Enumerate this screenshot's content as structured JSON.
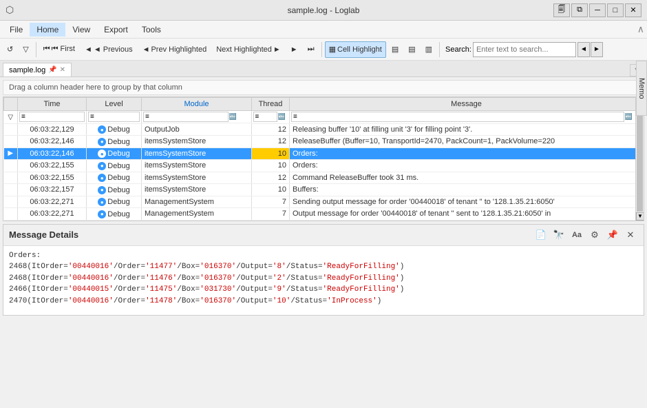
{
  "titleBar": {
    "icon": "⬡",
    "title": "sample.log - Loglab",
    "controls": [
      "🗐",
      "⧉",
      "─",
      "□",
      "✕"
    ]
  },
  "menuBar": {
    "items": [
      "File",
      "Home",
      "View",
      "Export",
      "Tools"
    ],
    "active": "Home"
  },
  "toolbar": {
    "refresh_label": "↺",
    "filter_label": "⊿",
    "first_label": "⏮ First",
    "prev_label": "◄ Previous",
    "prev_highlighted_label": "◄ Prev Highlighted",
    "next_highlighted_label": "Next Highlighted ►",
    "next_label": "Next ►",
    "last_label": "⏭",
    "cell_highlight_label": "Cell Highlight",
    "btn1_label": "▦",
    "btn2_label": "▤",
    "btn3_label": "▥",
    "search_label": "Search:",
    "search_placeholder": "Enter text to search..."
  },
  "tab": {
    "label": "sample.log",
    "pin": "📌"
  },
  "memo": "Memo",
  "dragHint": "Drag a column header here to group by that column",
  "table": {
    "columns": [
      "",
      "Time",
      "Level",
      "Module",
      "Thread",
      "Message"
    ],
    "filterRow": [
      "≡",
      "≡",
      "≡ c",
      "≡ c",
      "≡ c",
      "≡ c"
    ],
    "rows": [
      {
        "check": "",
        "time": "06:03:22,129",
        "level": "Debug",
        "module": "OutputJob",
        "thread": "12",
        "message": "Releasing buffer '10' at filling unit '3' for filling point '3'.",
        "selected": false,
        "arrow": false
      },
      {
        "check": "",
        "time": "06:03:22,146",
        "level": "Debug",
        "module": "itemsSystemStore",
        "thread": "12",
        "message": "ReleaseBuffer (Buffer=10, TransportId=2470, PackCount=1, PackVolume=220",
        "selected": false,
        "arrow": false
      },
      {
        "check": "",
        "time": "06:03:22,146",
        "level": "Debug",
        "module": "itemsSystemStore",
        "thread": "10",
        "message": "Orders:",
        "selected": true,
        "arrow": true,
        "yellowThread": true,
        "highlightMessage": true
      },
      {
        "check": "",
        "time": "06:03:22,155",
        "level": "Debug",
        "module": "itemsSystemStore",
        "thread": "10",
        "message": "Orders:",
        "selected": false,
        "arrow": false
      },
      {
        "check": "",
        "time": "06:03:22,155",
        "level": "Debug",
        "module": "itemsSystemStore",
        "thread": "12",
        "message": "Command ReleaseBuffer took 31 ms.",
        "selected": false,
        "arrow": false
      },
      {
        "check": "",
        "time": "06:03:22,157",
        "level": "Debug",
        "module": "itemsSystemStore",
        "thread": "10",
        "message": "Buffers:",
        "selected": false,
        "arrow": false
      },
      {
        "check": "",
        "time": "06:03:22,271",
        "level": "Debug",
        "module": "ManagementSystem",
        "thread": "7",
        "message": "Sending output message for order '00440018' of tenant '' to '128.1.35.21:6050'",
        "selected": false,
        "arrow": false
      },
      {
        "check": "",
        "time": "06:03:22,271",
        "level": "Debug",
        "module": "ManagementSystem",
        "thread": "7",
        "message": "Output message for order '00440018' of tenant '' sent to '128.1.35.21:6050' in",
        "selected": false,
        "arrow": false
      }
    ]
  },
  "messageDetails": {
    "title": "Message Details",
    "content": {
      "line1": "Orders:",
      "line2": "2468(ItOrder='00440016'/Order='11477'/Box='016370'/Output='8'/Status='ReadyForFilling')",
      "line3": "2468(ItOrder='00440016'/Order='11476'/Box='016370'/Output='2'/Status='ReadyForFilling')",
      "line4": "2466(ItOrder='00440015'/Order='11475'/Box='031730'/Output='9'/Status='ReadyForFilling')",
      "line5": "2470(ItOrder='00440016'/Order='11478'/Box='016370'/Output='10'/Status='InProcess')"
    },
    "tools": [
      "📄",
      "🔭",
      "Aa",
      "⚙",
      "📌",
      "✕"
    ]
  }
}
